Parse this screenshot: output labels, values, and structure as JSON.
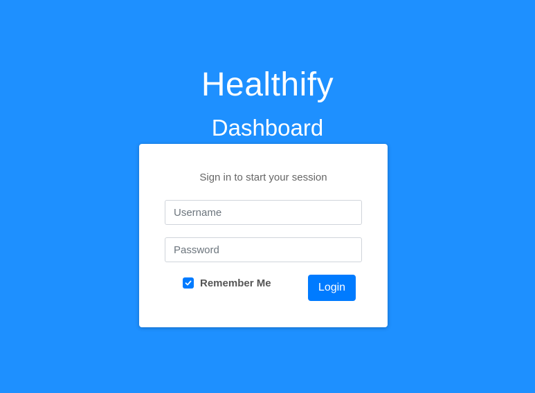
{
  "brand": {
    "title": "Healthify",
    "subtitle": "Dashboard"
  },
  "login": {
    "message": "Sign in to start your session",
    "username_placeholder": "Username",
    "password_placeholder": "Password",
    "remember_label": "Remember Me",
    "remember_checked": true,
    "login_label": "Login"
  },
  "colors": {
    "background": "#1e90ff",
    "accent": "#007bff",
    "card": "#ffffff"
  },
  "icons": {
    "checkbox": "check-icon"
  }
}
